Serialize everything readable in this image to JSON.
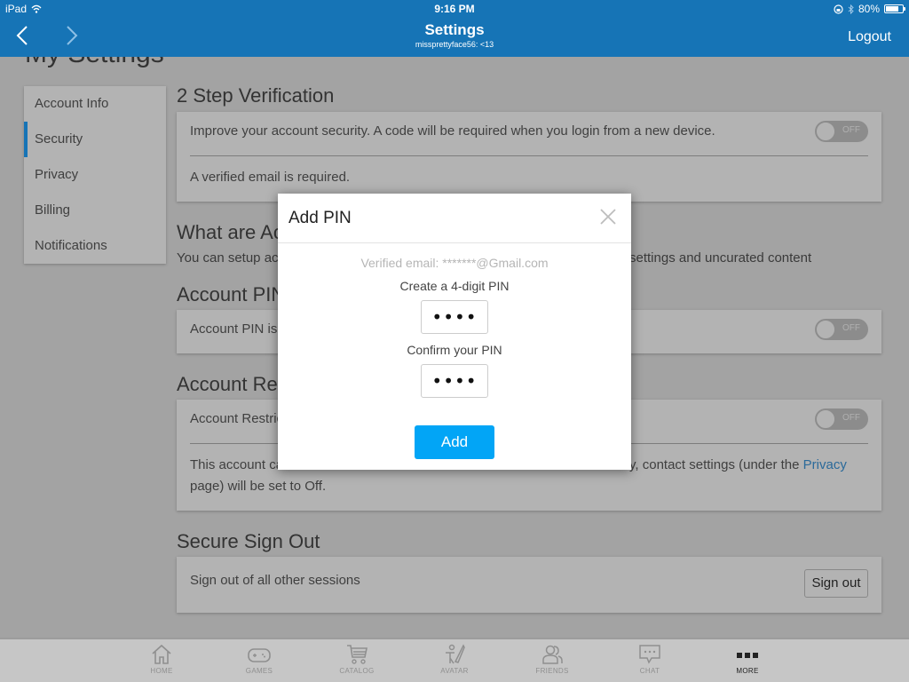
{
  "status_bar": {
    "device": "iPad",
    "time": "9:16 PM",
    "battery_percent": "80%",
    "battery_level": 0.8
  },
  "header": {
    "title": "Settings",
    "subtitle": "missprettyface56: <13",
    "logout_label": "Logout",
    "back_icon": "chevron-left-icon",
    "forward_icon": "chevron-right-icon"
  },
  "page": {
    "title": "My Settings"
  },
  "sidebar": {
    "items": [
      {
        "label": "Account Info",
        "active": false
      },
      {
        "label": "Security",
        "active": true
      },
      {
        "label": "Privacy",
        "active": false
      },
      {
        "label": "Billing",
        "active": false
      },
      {
        "label": "Notifications",
        "active": false
      }
    ]
  },
  "sections": {
    "two_step": {
      "heading": "2 Step Verification",
      "description": "Improve your account security. A code will be required when you login from a new device.",
      "note": "A verified email is required.",
      "toggle": "OFF"
    },
    "what_are": {
      "heading": "What are Ac",
      "text_left": "You can setup acc",
      "text_right": "settings and uncurated content"
    },
    "account_pin": {
      "heading": "Account PIN",
      "text": "Account PIN is o",
      "toggle": "OFF"
    },
    "account_restrictions": {
      "heading": "Account Res",
      "label": "Account Restric",
      "toggle": "OFF",
      "text_left": "This account ca",
      "text_right": "y, contact settings (under the ",
      "link": "Privacy",
      "text_line2": "page) will be set to Off."
    },
    "secure_sign_out": {
      "heading": "Secure Sign Out",
      "text": "Sign out of all other sessions",
      "button": "Sign out"
    }
  },
  "modal": {
    "title": "Add PIN",
    "verified_email": "Verified email: *******@Gmail.com",
    "create_label": "Create a 4-digit PIN",
    "create_value": "••••",
    "confirm_label": "Confirm your PIN",
    "confirm_value": "••••",
    "add_button": "Add"
  },
  "bottom_nav": {
    "tabs": [
      {
        "label": "HOME",
        "icon": "home-icon",
        "active": false
      },
      {
        "label": "GAMES",
        "icon": "gamepad-icon",
        "active": false
      },
      {
        "label": "CATALOG",
        "icon": "cart-icon",
        "active": false
      },
      {
        "label": "AVATAR",
        "icon": "avatar-icon",
        "active": false
      },
      {
        "label": "FRIENDS",
        "icon": "friends-icon",
        "active": false
      },
      {
        "label": "CHAT",
        "icon": "chat-icon",
        "active": false
      },
      {
        "label": "MORE",
        "icon": "more-icon",
        "active": true
      }
    ]
  },
  "colors": {
    "header_blue": "#1674b6",
    "add_button": "#02a5f6",
    "link": "#2b6a9a"
  }
}
